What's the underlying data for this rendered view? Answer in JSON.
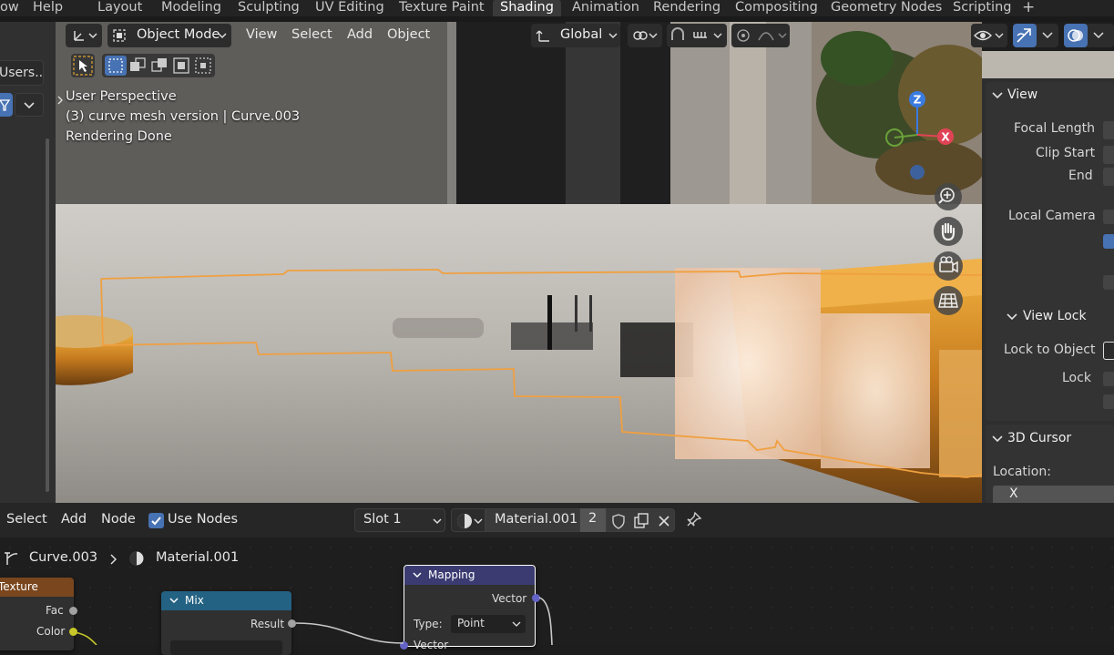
{
  "menubar": {
    "left_items": [
      "ow",
      "Help"
    ],
    "workspace_tabs": [
      "Layout",
      "Modeling",
      "Sculpting",
      "UV Editing",
      "Texture Paint",
      "Shading",
      "Animation",
      "Rendering",
      "Compositing",
      "Geometry Nodes",
      "Scripting"
    ],
    "active_tab": "Shading",
    "add_tab": "+"
  },
  "left_panel": {
    "users_button": "Users..."
  },
  "viewport_header": {
    "mode": "Object Mode",
    "menus": [
      "View",
      "Select",
      "Add",
      "Object"
    ],
    "transform_orientation": "Global"
  },
  "viewport": {
    "perspective": "User Perspective",
    "object_info": "(3) curve mesh version | Curve.003",
    "status": "Rendering Done",
    "gizmo": {
      "z": "Z",
      "x": "X"
    }
  },
  "npanel": {
    "view_header": "View",
    "focal_length": "Focal Length",
    "clip_start": "Clip Start",
    "clip_end": "End",
    "local_camera": "Local Camera",
    "view_lock_header": "View Lock",
    "lock_to_object": "Lock to Object",
    "lock": "Lock",
    "cursor_header": "3D Cursor",
    "location": "Location:",
    "x_field": "X"
  },
  "node_header": {
    "menus": [
      "Select",
      "Add",
      "Node"
    ],
    "use_nodes_label": "Use Nodes",
    "use_nodes_checked": true,
    "slot": "Slot 1",
    "material_name": "Material.001",
    "material_users": "2"
  },
  "node_breadcrumb": {
    "object": "Curve.003",
    "material": "Material.001"
  },
  "nodes": {
    "texture": {
      "title": "Texture",
      "fac": "Fac",
      "color": "Color"
    },
    "mix": {
      "title": "Mix",
      "result": "Result"
    },
    "mapping": {
      "title": "Mapping",
      "vector_out": "Vector",
      "type_label": "Type:",
      "type_value": "Point",
      "vector_in": "Vector"
    }
  },
  "colors": {
    "accent_blue": "#4772b3",
    "selection_orange": "#f0a040",
    "mapping_header": "#3b3b72",
    "mix_header": "#246283",
    "texture_header": "#79461d"
  }
}
